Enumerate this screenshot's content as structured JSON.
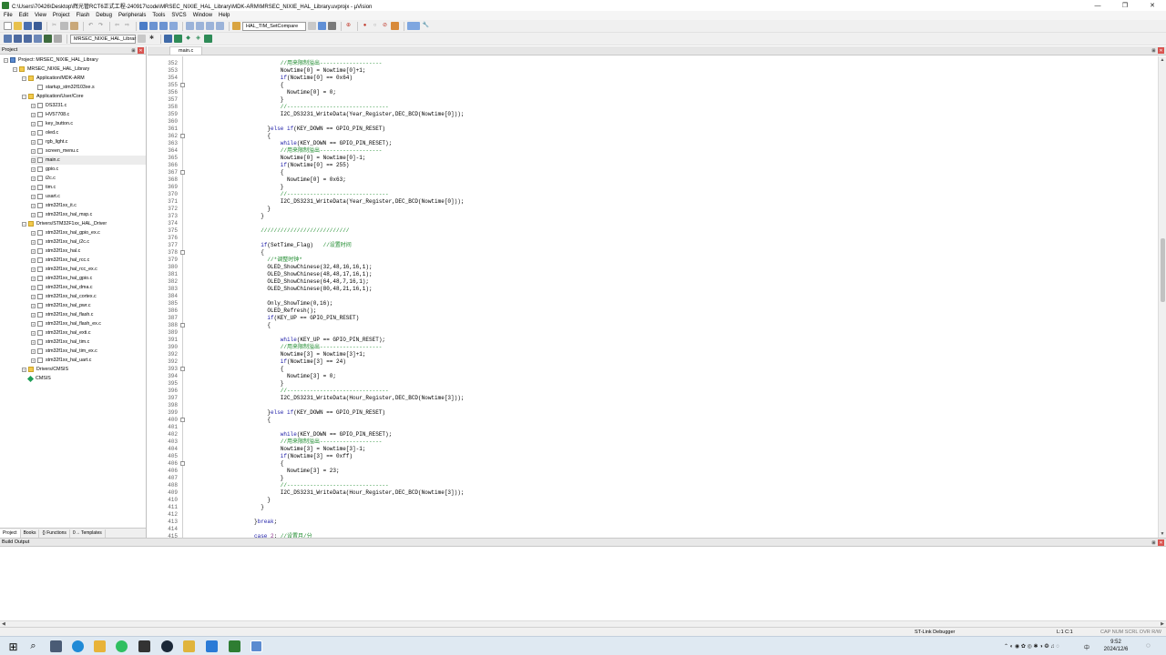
{
  "window": {
    "title": "C:\\Users\\70426\\Desktop\\辉光管RCT6正式工程-240917\\code\\MRSEC_NIXIE_HAL_Library\\MDK-ARM\\MRSEC_NIXIE_HAL_Library.uvprojx - µVision",
    "minimize": "—",
    "maximize": "❐",
    "close": "✕"
  },
  "menu": [
    "File",
    "Edit",
    "View",
    "Project",
    "Flash",
    "Debug",
    "Peripherals",
    "Tools",
    "SVCS",
    "Window",
    "Help"
  ],
  "toolbar": {
    "find_combo": "HAL_TIM_SetCompare",
    "target_combo": "MRSEC_NIXIE_HAL_Librar"
  },
  "project": {
    "title": "Project",
    "tabs": [
      "Project",
      "Books",
      "{} Functions",
      "0→ Templates"
    ],
    "tree": [
      {
        "label": "Project: MRSEC_NIXIE_HAL_Library",
        "level": 0,
        "kind": "proj",
        "expanded": true
      },
      {
        "label": "MRSEC_NIXIE_HAL_Library",
        "level": 1,
        "kind": "folder",
        "expanded": true
      },
      {
        "label": "Application/MDK-ARM",
        "level": 2,
        "kind": "folder",
        "expanded": true
      },
      {
        "label": "startup_stm32f103xe.s",
        "level": 3,
        "kind": "file",
        "expanded": null
      },
      {
        "label": "Application/User/Core",
        "level": 2,
        "kind": "folder",
        "expanded": true
      },
      {
        "label": "DS3231.c",
        "level": 3,
        "kind": "file",
        "expanded": false
      },
      {
        "label": "HV57708.c",
        "level": 3,
        "kind": "file",
        "expanded": false
      },
      {
        "label": "key_button.c",
        "level": 3,
        "kind": "file",
        "expanded": false
      },
      {
        "label": "oled.c",
        "level": 3,
        "kind": "file",
        "expanded": false
      },
      {
        "label": "rgb_light.c",
        "level": 3,
        "kind": "file",
        "expanded": false
      },
      {
        "label": "screen_menu.c",
        "level": 3,
        "kind": "file",
        "expanded": false
      },
      {
        "label": "main.c",
        "level": 3,
        "kind": "file",
        "expanded": false,
        "selected": true
      },
      {
        "label": "gpio.c",
        "level": 3,
        "kind": "file",
        "expanded": false
      },
      {
        "label": "i2c.c",
        "level": 3,
        "kind": "file",
        "expanded": false
      },
      {
        "label": "tim.c",
        "level": 3,
        "kind": "file",
        "expanded": false
      },
      {
        "label": "usart.c",
        "level": 3,
        "kind": "file",
        "expanded": false
      },
      {
        "label": "stm32f1xx_it.c",
        "level": 3,
        "kind": "file",
        "expanded": false
      },
      {
        "label": "stm32f1xx_hal_msp.c",
        "level": 3,
        "kind": "file",
        "expanded": false
      },
      {
        "label": "Drivers/STM32F1xx_HAL_Driver",
        "level": 2,
        "kind": "folder",
        "expanded": true
      },
      {
        "label": "stm32f1xx_hal_gpio_ex.c",
        "level": 3,
        "kind": "file",
        "expanded": false
      },
      {
        "label": "stm32f1xx_hal_i2c.c",
        "level": 3,
        "kind": "file",
        "expanded": false
      },
      {
        "label": "stm32f1xx_hal.c",
        "level": 3,
        "kind": "file",
        "expanded": false
      },
      {
        "label": "stm32f1xx_hal_rcc.c",
        "level": 3,
        "kind": "file",
        "expanded": false
      },
      {
        "label": "stm32f1xx_hal_rcc_ex.c",
        "level": 3,
        "kind": "file",
        "expanded": false
      },
      {
        "label": "stm32f1xx_hal_gpio.c",
        "level": 3,
        "kind": "file",
        "expanded": false
      },
      {
        "label": "stm32f1xx_hal_dma.c",
        "level": 3,
        "kind": "file",
        "expanded": false
      },
      {
        "label": "stm32f1xx_hal_cortex.c",
        "level": 3,
        "kind": "file",
        "expanded": false
      },
      {
        "label": "stm32f1xx_hal_pwr.c",
        "level": 3,
        "kind": "file",
        "expanded": false
      },
      {
        "label": "stm32f1xx_hal_flash.c",
        "level": 3,
        "kind": "file",
        "expanded": false
      },
      {
        "label": "stm32f1xx_hal_flash_ex.c",
        "level": 3,
        "kind": "file",
        "expanded": false
      },
      {
        "label": "stm32f1xx_hal_exti.c",
        "level": 3,
        "kind": "file",
        "expanded": false
      },
      {
        "label": "stm32f1xx_hal_tim.c",
        "level": 3,
        "kind": "file",
        "expanded": false
      },
      {
        "label": "stm32f1xx_hal_tim_ex.c",
        "level": 3,
        "kind": "file",
        "expanded": false
      },
      {
        "label": "stm32f1xx_hal_uart.c",
        "level": 3,
        "kind": "file",
        "expanded": false
      },
      {
        "label": "Drivers/CMSIS",
        "level": 2,
        "kind": "folder",
        "expanded": false
      },
      {
        "label": "CMSIS",
        "level": 2,
        "kind": "cmsis",
        "expanded": null
      }
    ]
  },
  "editor": {
    "tab": "main.c",
    "lines": [
      {
        "n": "352",
        "fold": "",
        "ind": 16,
        "segs": [
          [
            "cm",
            "//用来限制溢出-------------------"
          ]
        ]
      },
      {
        "n": "353",
        "fold": "",
        "ind": 16,
        "segs": [
          [
            "tx",
            "Nowtime[0] = Nowtime[0]+1;"
          ]
        ]
      },
      {
        "n": "354",
        "fold": "",
        "ind": 16,
        "segs": [
          [
            "kw",
            "if"
          ],
          [
            "tx",
            "(Nowtime[0] == 0x64)"
          ]
        ]
      },
      {
        "n": "355",
        "fold": "⊟",
        "ind": 16,
        "segs": [
          [
            "tx",
            "{"
          ]
        ]
      },
      {
        "n": "356",
        "fold": "",
        "ind": 18,
        "segs": [
          [
            "tx",
            "Nowtime[0] = 0;"
          ]
        ]
      },
      {
        "n": "357",
        "fold": "",
        "ind": 16,
        "segs": [
          [
            "tx",
            "}"
          ]
        ]
      },
      {
        "n": "358",
        "fold": "",
        "ind": 16,
        "segs": [
          [
            "cm",
            "//-------------------------------"
          ]
        ]
      },
      {
        "n": "359",
        "fold": "",
        "ind": 16,
        "segs": [
          [
            "tx",
            "I2C_DS3231_WriteData(Year_Register,DEC_BCD(Nowtime[0]));"
          ]
        ]
      },
      {
        "n": "360",
        "fold": "",
        "ind": 0,
        "segs": []
      },
      {
        "n": "361",
        "fold": "",
        "ind": 12,
        "segs": [
          [
            "tx",
            "}"
          ],
          [
            "kw",
            "else if"
          ],
          [
            "tx",
            "(KEY_DOWN == GPIO_PIN_RESET)"
          ]
        ]
      },
      {
        "n": "362",
        "fold": "⊟",
        "ind": 12,
        "segs": [
          [
            "tx",
            "{"
          ]
        ]
      },
      {
        "n": "363",
        "fold": "",
        "ind": 16,
        "segs": [
          [
            "kw",
            "while"
          ],
          [
            "tx",
            "(KEY_DOWN == GPIO_PIN_RESET);"
          ]
        ]
      },
      {
        "n": "364",
        "fold": "",
        "ind": 16,
        "segs": [
          [
            "cm",
            "//用来限制溢出-------------------"
          ]
        ]
      },
      {
        "n": "365",
        "fold": "",
        "ind": 16,
        "segs": [
          [
            "tx",
            "Nowtime[0] = Nowtime[0]-1;"
          ]
        ]
      },
      {
        "n": "366",
        "fold": "",
        "ind": 16,
        "segs": [
          [
            "kw",
            "if"
          ],
          [
            "tx",
            "(Nowtime[0] == 255)"
          ]
        ]
      },
      {
        "n": "367",
        "fold": "⊟",
        "ind": 16,
        "segs": [
          [
            "tx",
            "{"
          ]
        ]
      },
      {
        "n": "368",
        "fold": "",
        "ind": 18,
        "segs": [
          [
            "tx",
            "Nowtime[0] = 0x63;"
          ]
        ]
      },
      {
        "n": "369",
        "fold": "",
        "ind": 16,
        "segs": [
          [
            "tx",
            "}"
          ]
        ]
      },
      {
        "n": "370",
        "fold": "",
        "ind": 16,
        "segs": [
          [
            "cm",
            "//-------------------------------"
          ]
        ]
      },
      {
        "n": "371",
        "fold": "",
        "ind": 16,
        "segs": [
          [
            "tx",
            "I2C_DS3231_WriteData(Year_Register,DEC_BCD(Nowtime[0]));"
          ]
        ]
      },
      {
        "n": "372",
        "fold": "",
        "ind": 12,
        "segs": [
          [
            "tx",
            "}"
          ]
        ]
      },
      {
        "n": "373",
        "fold": "",
        "ind": 10,
        "segs": [
          [
            "tx",
            "}"
          ]
        ]
      },
      {
        "n": "374",
        "fold": "",
        "ind": 0,
        "segs": []
      },
      {
        "n": "375",
        "fold": "",
        "ind": 10,
        "segs": [
          [
            "cm",
            "///////////////////////////"
          ]
        ]
      },
      {
        "n": "376",
        "fold": "",
        "ind": 0,
        "segs": []
      },
      {
        "n": "377",
        "fold": "",
        "ind": 10,
        "segs": [
          [
            "kw",
            "if"
          ],
          [
            "tx",
            "(SetTime_Flag)   "
          ],
          [
            "cm",
            "//设置时间"
          ]
        ]
      },
      {
        "n": "378",
        "fold": "⊟",
        "ind": 10,
        "segs": [
          [
            "tx",
            "{"
          ]
        ]
      },
      {
        "n": "379",
        "fold": "",
        "ind": 12,
        "segs": [
          [
            "cm",
            "//*调整时钟*"
          ]
        ]
      },
      {
        "n": "380",
        "fold": "",
        "ind": 12,
        "segs": [
          [
            "tx",
            "OLED_ShowChinese(32,48,16,16,1);"
          ]
        ]
      },
      {
        "n": "381",
        "fold": "",
        "ind": 12,
        "segs": [
          [
            "tx",
            "OLED_ShowChinese(48,48,17,16,1);"
          ]
        ]
      },
      {
        "n": "382",
        "fold": "",
        "ind": 12,
        "segs": [
          [
            "tx",
            "OLED_ShowChinese(64,48,7,16,1);"
          ]
        ]
      },
      {
        "n": "383",
        "fold": "",
        "ind": 12,
        "segs": [
          [
            "tx",
            "OLED_ShowChinese(80,48,21,16,1);"
          ]
        ]
      },
      {
        "n": "384",
        "fold": "",
        "ind": 0,
        "segs": []
      },
      {
        "n": "385",
        "fold": "",
        "ind": 12,
        "segs": [
          [
            "tx",
            "Only_ShowTime(0,16);"
          ]
        ]
      },
      {
        "n": "386",
        "fold": "",
        "ind": 12,
        "segs": [
          [
            "tx",
            "OLED_Refresh();"
          ]
        ]
      },
      {
        "n": "387",
        "fold": "",
        "ind": 12,
        "segs": [
          [
            "kw",
            "if"
          ],
          [
            "tx",
            "(KEY_UP == GPIO_PIN_RESET)"
          ]
        ]
      },
      {
        "n": "388",
        "fold": "⊟",
        "ind": 12,
        "segs": [
          [
            "tx",
            "{"
          ]
        ]
      },
      {
        "n": "389",
        "fold": "",
        "ind": 0,
        "segs": []
      },
      {
        "n": "391",
        "fold": "",
        "ind": 16,
        "segs": [
          [
            "kw",
            "while"
          ],
          [
            "tx",
            "(KEY_UP == GPIO_PIN_RESET);"
          ]
        ]
      },
      {
        "n": "390",
        "fold": "",
        "ind": 16,
        "segs": [
          [
            "cm",
            "//用来限制溢出-------------------"
          ]
        ]
      },
      {
        "n": "392",
        "fold": "",
        "ind": 16,
        "segs": [
          [
            "tx",
            "Nowtime[3] = Nowtime[3]+1;"
          ]
        ]
      },
      {
        "n": "392",
        "fold": "",
        "ind": 16,
        "segs": [
          [
            "kw",
            "if"
          ],
          [
            "tx",
            "(Nowtime[3] == 24)"
          ]
        ]
      },
      {
        "n": "393",
        "fold": "⊟",
        "ind": 16,
        "segs": [
          [
            "tx",
            "{"
          ]
        ]
      },
      {
        "n": "394",
        "fold": "",
        "ind": 18,
        "segs": [
          [
            "tx",
            "Nowtime[3] = 0;"
          ]
        ]
      },
      {
        "n": "395",
        "fold": "",
        "ind": 16,
        "segs": [
          [
            "tx",
            "}"
          ]
        ]
      },
      {
        "n": "396",
        "fold": "",
        "ind": 16,
        "segs": [
          [
            "cm",
            "//-------------------------------"
          ]
        ]
      },
      {
        "n": "397",
        "fold": "",
        "ind": 16,
        "segs": [
          [
            "tx",
            "I2C_DS3231_WriteData(Hour_Register,DEC_BCD(Nowtime[3]));"
          ]
        ]
      },
      {
        "n": "398",
        "fold": "",
        "ind": 0,
        "segs": []
      },
      {
        "n": "399",
        "fold": "",
        "ind": 12,
        "segs": [
          [
            "tx",
            "}"
          ],
          [
            "kw",
            "else if"
          ],
          [
            "tx",
            "(KEY_DOWN == GPIO_PIN_RESET)"
          ]
        ]
      },
      {
        "n": "400",
        "fold": "⊟",
        "ind": 12,
        "segs": [
          [
            "tx",
            "{"
          ]
        ]
      },
      {
        "n": "401",
        "fold": "",
        "ind": 0,
        "segs": []
      },
      {
        "n": "402",
        "fold": "",
        "ind": 16,
        "segs": [
          [
            "kw",
            "while"
          ],
          [
            "tx",
            "(KEY_DOWN == GPIO_PIN_RESET);"
          ]
        ]
      },
      {
        "n": "403",
        "fold": "",
        "ind": 16,
        "segs": [
          [
            "cm",
            "//用来限制溢出-------------------"
          ]
        ]
      },
      {
        "n": "404",
        "fold": "",
        "ind": 16,
        "segs": [
          [
            "tx",
            "Nowtime[3] = Nowtime[3]-1;"
          ]
        ]
      },
      {
        "n": "405",
        "fold": "",
        "ind": 16,
        "segs": [
          [
            "kw",
            "if"
          ],
          [
            "tx",
            "(Nowtime[3] == 0xff)"
          ]
        ]
      },
      {
        "n": "406",
        "fold": "⊟",
        "ind": 16,
        "segs": [
          [
            "tx",
            "{"
          ]
        ]
      },
      {
        "n": "406",
        "fold": "",
        "ind": 18,
        "segs": [
          [
            "tx",
            "Nowtime[3] = 23;"
          ]
        ]
      },
      {
        "n": "407",
        "fold": "",
        "ind": 16,
        "segs": [
          [
            "tx",
            "}"
          ]
        ]
      },
      {
        "n": "408",
        "fold": "",
        "ind": 16,
        "segs": [
          [
            "cm",
            "//-------------------------------"
          ]
        ]
      },
      {
        "n": "409",
        "fold": "",
        "ind": 16,
        "segs": [
          [
            "tx",
            "I2C_DS3231_WriteData(Hour_Register,DEC_BCD(Nowtime[3]));"
          ]
        ]
      },
      {
        "n": "410",
        "fold": "",
        "ind": 12,
        "segs": [
          [
            "tx",
            "}"
          ]
        ]
      },
      {
        "n": "411",
        "fold": "",
        "ind": 10,
        "segs": [
          [
            "tx",
            "}"
          ]
        ]
      },
      {
        "n": "412",
        "fold": "",
        "ind": 0,
        "segs": []
      },
      {
        "n": "413",
        "fold": "",
        "ind": 8,
        "segs": [
          [
            "tx",
            "}"
          ],
          [
            "kw",
            "break"
          ],
          [
            "tx",
            ";"
          ]
        ]
      },
      {
        "n": "414",
        "fold": "",
        "ind": 0,
        "segs": []
      },
      {
        "n": "415",
        "fold": "",
        "ind": 8,
        "segs": [
          [
            "kw",
            "case"
          ],
          [
            "nm",
            " 2"
          ],
          [
            "tx",
            ": "
          ],
          [
            "cm",
            "//设置月/分"
          ]
        ]
      },
      {
        "n": "416",
        "fold": "⊟",
        "ind": 8,
        "segs": [
          [
            "tx",
            "{"
          ]
        ]
      }
    ]
  },
  "build_output": {
    "title": "Build Output"
  },
  "status": {
    "debugger": "ST-Link Debugger",
    "position": "L:1 C:1",
    "flags": "CAP  NUM  SCRL  OVR  R/W"
  },
  "taskbar": {
    "ime": "中",
    "time": "9:52",
    "date": "2024/12/6"
  }
}
